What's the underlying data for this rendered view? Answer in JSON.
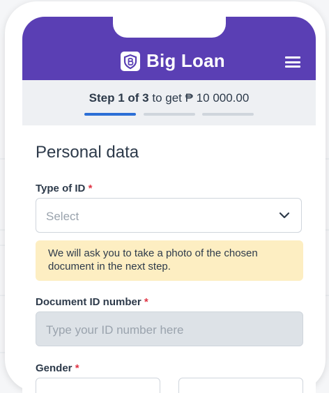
{
  "header": {
    "brand": "Big Loan",
    "logo_icon": "shield-b-icon",
    "menu_icon": "hamburger-menu-icon",
    "brand_color": "#5a3fb4"
  },
  "steps": {
    "step_bold": "Step 1 of 3",
    "step_rest": " to get ₱ 10 000.00",
    "current_step": 1,
    "total_steps": 3,
    "active_color": "#2c6fd6"
  },
  "form": {
    "title": "Personal data",
    "type_of_id": {
      "label": "Type of ID",
      "required_mark": "*",
      "value": "Select"
    },
    "notice": "We will ask you to take a photo of the chosen document in the next step.",
    "document_id": {
      "label": "Document ID number",
      "required_mark": "*",
      "placeholder": "Type your ID number here",
      "value": ""
    },
    "gender": {
      "label": "Gender",
      "required_mark": "*"
    }
  }
}
